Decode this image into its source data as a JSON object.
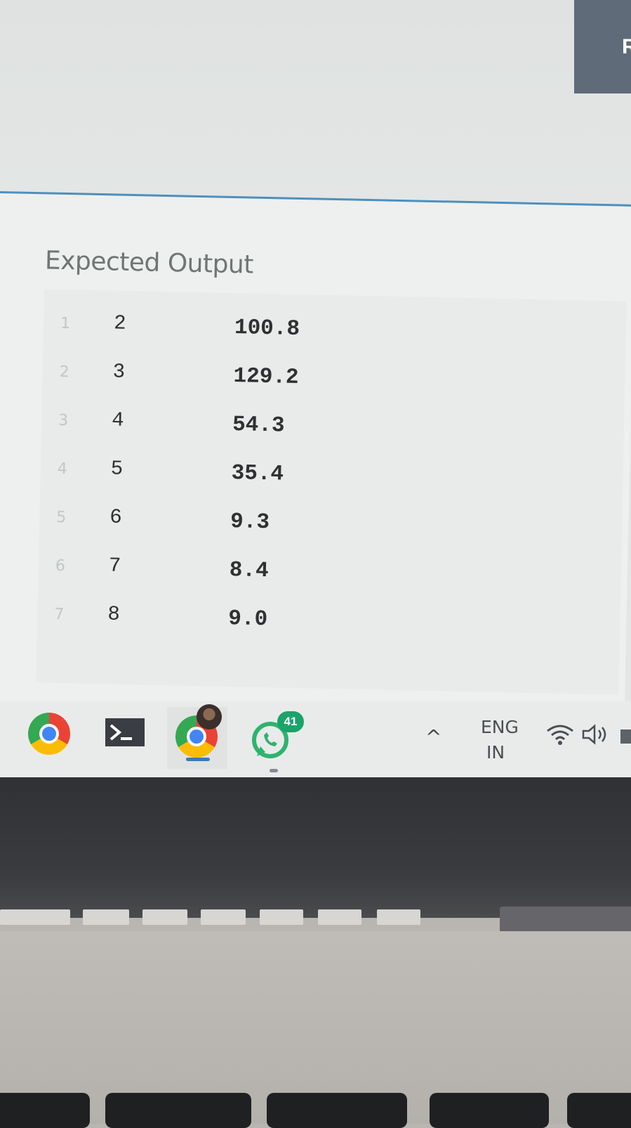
{
  "top_right_button": {
    "label": "R"
  },
  "output_panel": {
    "title": "Expected Output",
    "lines": [
      {
        "line_number": "1",
        "col1": "2",
        "col2": "100.8"
      },
      {
        "line_number": "2",
        "col1": "3",
        "col2": "129.2"
      },
      {
        "line_number": "3",
        "col1": "4",
        "col2": "54.3"
      },
      {
        "line_number": "4",
        "col1": "5",
        "col2": "35.4"
      },
      {
        "line_number": "5",
        "col1": "6",
        "col2": "9.3"
      },
      {
        "line_number": "6",
        "col1": "7",
        "col2": "8.4"
      },
      {
        "line_number": "7",
        "col1": "8",
        "col2": "9.0"
      }
    ]
  },
  "taskbar": {
    "pinned": [
      {
        "name": "chrome",
        "icon": "chrome-icon"
      },
      {
        "name": "terminal",
        "icon": "terminal-icon"
      },
      {
        "name": "chrome-profile",
        "icon": "chrome-icon",
        "active": true
      },
      {
        "name": "whatsapp",
        "icon": "whatsapp-icon",
        "badge": "41"
      }
    ],
    "tray": {
      "chevron": "^",
      "language_line1": "ENG",
      "language_line2": "IN",
      "icons": [
        "wifi-icon",
        "volume-icon",
        "battery-icon"
      ]
    }
  },
  "colors": {
    "accent_border": "#4d8fbf",
    "badge_green": "#1ba36a",
    "active_indicator": "#3e7bb5"
  }
}
